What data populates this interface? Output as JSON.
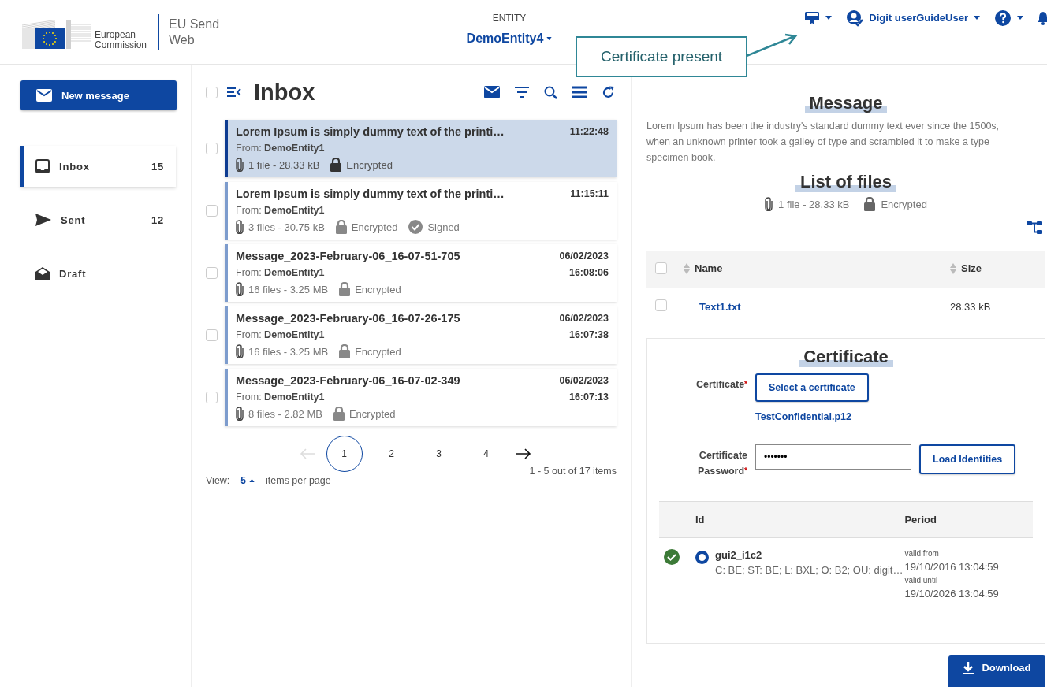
{
  "header": {
    "logo_text": [
      "European",
      "Commission"
    ],
    "app_name": [
      "EU Send",
      "Web"
    ],
    "entity_label": "ENTITY",
    "entity": "DemoEntity4",
    "user": "Digit userGuideUser"
  },
  "callout": {
    "text": "Certificate present"
  },
  "sidebar": {
    "new_button": "New message",
    "items": [
      {
        "label": "Inbox",
        "count": "15",
        "kind": "inbox",
        "selected": true
      },
      {
        "label": "Sent",
        "count": "12",
        "kind": "sent",
        "selected": false
      },
      {
        "label": "Draft",
        "kind": "draft",
        "selected": false
      }
    ]
  },
  "inbox": {
    "title": "Inbox",
    "select_all_checked": false,
    "messages": [
      {
        "title": "Lorem Ipsum is simply dummy text of the printi…",
        "from_label": "From:",
        "from": "DemoEntity1",
        "files": "1 file - 28.33 kB",
        "encrypted": "Encrypted",
        "time": "11:22:48",
        "selected": true,
        "checked": false
      },
      {
        "title": "Lorem Ipsum is simply dummy text of the printi…",
        "from_label": "From:",
        "from": "DemoEntity1",
        "files": "3 files - 30.75 kB",
        "encrypted": "Encrypted",
        "signed": "Signed",
        "time": "11:15:11",
        "selected": false,
        "checked": false
      },
      {
        "title": "Message_2023-February-06_16-07-51-705",
        "from_label": "From:",
        "from": "DemoEntity1",
        "files": "16 files - 3.25 MB",
        "encrypted": "Encrypted",
        "date": "06/02/2023",
        "time": "16:08:06",
        "selected": false,
        "checked": false
      },
      {
        "title": "Message_2023-February-06_16-07-26-175",
        "from_label": "From:",
        "from": "DemoEntity1",
        "files": "16 files - 3.25 MB",
        "encrypted": "Encrypted",
        "date": "06/02/2023",
        "time": "16:07:38",
        "selected": false,
        "checked": false
      },
      {
        "title": "Message_2023-February-06_16-07-02-349",
        "from_label": "From:",
        "from": "DemoEntity1",
        "files": "8 files - 2.82 MB",
        "encrypted": "Encrypted",
        "date": "06/02/2023",
        "time": "16:07:13",
        "selected": false,
        "checked": false
      }
    ],
    "pages": [
      {
        "label": "1",
        "selected": true
      },
      {
        "label": "2",
        "selected": false
      },
      {
        "label": "3",
        "selected": false
      },
      {
        "label": "4",
        "selected": false
      }
    ],
    "prev_disabled": true,
    "view_label": "View:",
    "per_page": "5",
    "per_page_label": "items per page",
    "range": "1 - 5 out of 17 items"
  },
  "detail": {
    "message_heading": "Message",
    "body": "Lorem Ipsum has been the industry's standard dummy text ever since the 1500s, when an unknown printer took a galley of type and scrambled it to make a type specimen book.",
    "files_heading": "List of files",
    "files_summary": "1 file - 28.33 kB",
    "encrypted": "Encrypted",
    "file_table": {
      "select_all_checked": false,
      "columns": [
        "Name",
        "Size"
      ],
      "rows": [
        {
          "name": "Text1.txt",
          "size": "28.33 kB",
          "checked": false
        }
      ]
    },
    "certificate": {
      "heading": "Certificate",
      "required_mark": "*",
      "cert_label": "Certificate",
      "select_button": "Select a certificate",
      "file": "TestConfidential.p12",
      "password_label": [
        "Certificate",
        "Password"
      ],
      "password": "•••••••",
      "load_button": "Load Identities",
      "columns": [
        "Id",
        "Period"
      ],
      "identities": [
        {
          "id": "gui2_i1c2",
          "subject": "C: BE; ST: BE; L: BXL; O: B2; OU: digit…",
          "valid_from_label": "valid from",
          "valid_from": "19/10/2016 13:04:59",
          "valid_until_label": "valid until",
          "valid_until": "19/10/2026 13:04:59",
          "valid": true,
          "selected": true
        }
      ]
    },
    "download_button": "Download"
  }
}
